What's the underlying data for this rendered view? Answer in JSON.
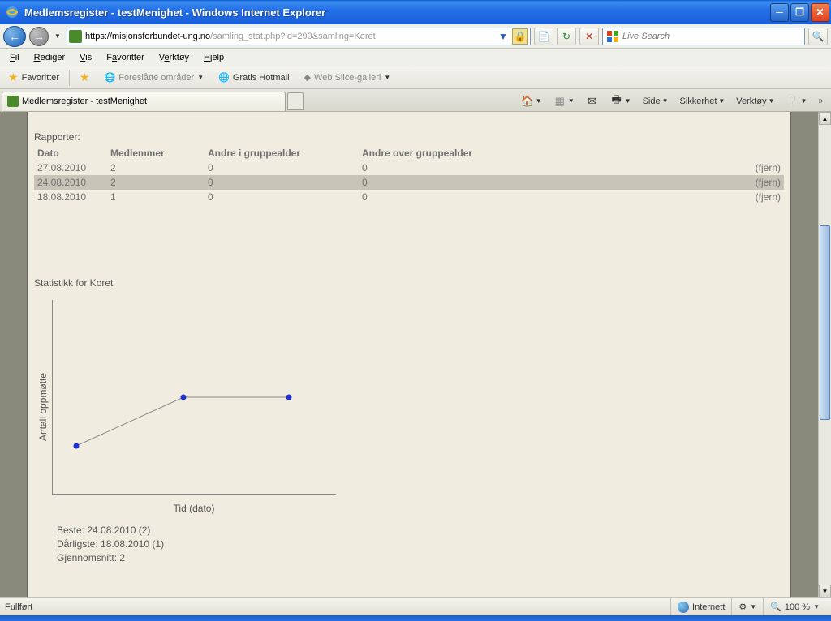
{
  "window": {
    "title": "Medlemsregister - testMenighet - Windows Internet Explorer"
  },
  "nav": {
    "url_black": "https://misjonsforbundet-ung.no",
    "url_gray": "/samling_stat.php?id=299&samling=Koret",
    "search_placeholder": "Live Search"
  },
  "menu": {
    "fil": "Fil",
    "rediger": "Rediger",
    "vis": "Vis",
    "favoritter": "Favoritter",
    "verktoy": "Verktøy",
    "hjelp": "Hjelp"
  },
  "favbar": {
    "favoritter": "Favoritter",
    "foreslatte": "Foreslåtte områder",
    "hotmail": "Gratis Hotmail",
    "webslice": "Web Slice-galleri"
  },
  "tab": {
    "title": "Medlemsregister - testMenighet"
  },
  "toolbar": {
    "side": "Side",
    "sikkerhet": "Sikkerhet",
    "verktoy": "Verktøy"
  },
  "page": {
    "rapporter": "Rapporter:",
    "headers": {
      "dato": "Dato",
      "medlemmer": "Medlemmer",
      "andre_i": "Andre i gruppealder",
      "andre_over": "Andre over gruppealder"
    },
    "rows": [
      {
        "dato": "27.08.2010",
        "medlemmer": "2",
        "andre_i": "0",
        "andre_over": "0",
        "fjern": "(fjern)"
      },
      {
        "dato": "24.08.2010",
        "medlemmer": "2",
        "andre_i": "0",
        "andre_over": "0",
        "fjern": "(fjern)"
      },
      {
        "dato": "18.08.2010",
        "medlemmer": "1",
        "andre_i": "0",
        "andre_over": "0",
        "fjern": "(fjern)"
      }
    ],
    "chart_title": "Statistikk for Koret",
    "ylabel": "Antall oppmøtte",
    "xlabel": "Tid (dato)",
    "beste": "Beste: 24.08.2010 (2)",
    "darligste": "Dårligste: 18.08.2010 (1)",
    "gjennomsnitt": "Gjennomsnitt: 2"
  },
  "status": {
    "left": "Fullført",
    "internett": "Internett",
    "zoom": "100 %"
  },
  "chart_data": {
    "type": "line",
    "title": "Statistikk for Koret",
    "xlabel": "Tid (dato)",
    "ylabel": "Antall oppmøtte",
    "x": [
      "18.08.2010",
      "24.08.2010",
      "27.08.2010"
    ],
    "values": [
      1,
      2,
      2
    ],
    "ylim": [
      0,
      3
    ]
  }
}
